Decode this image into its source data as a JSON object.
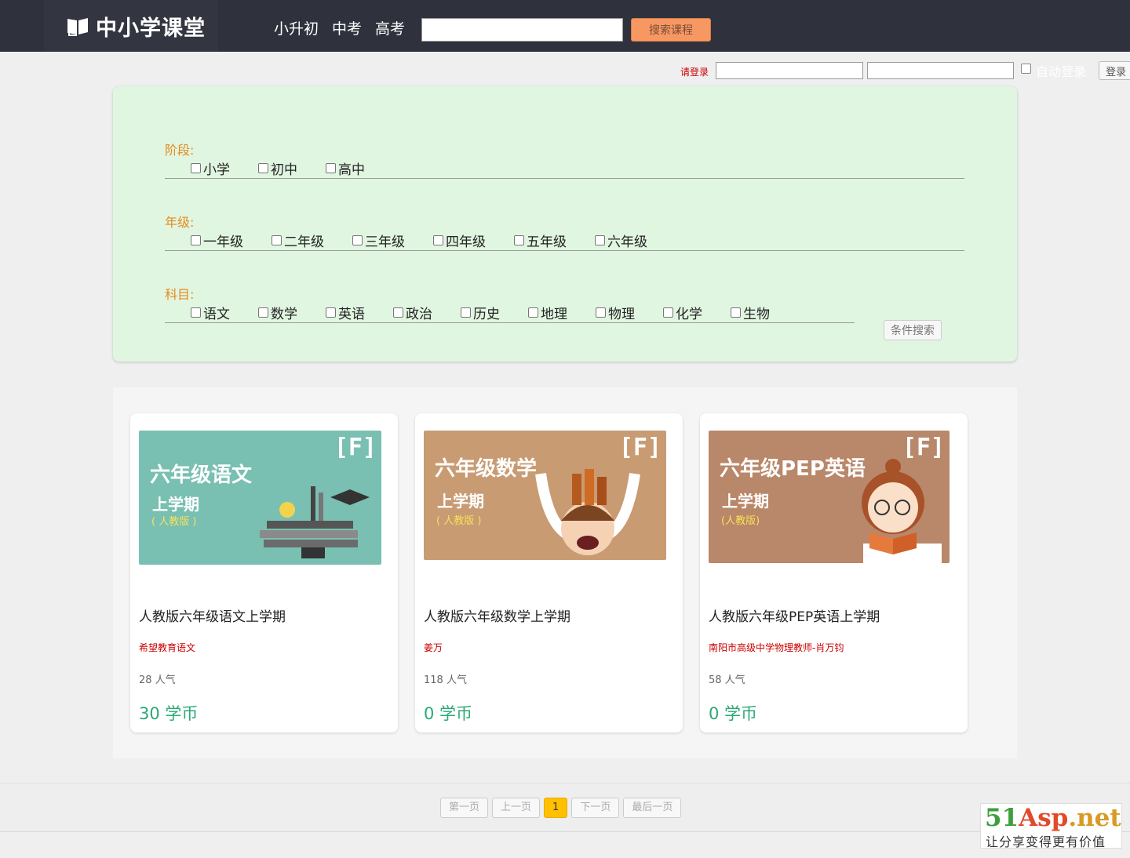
{
  "header": {
    "logo_text": "中小学课堂",
    "nav": [
      "小升初",
      "中考",
      "高考"
    ],
    "search_placeholder": "",
    "search_button": "搜索课程"
  },
  "login": {
    "hint": "请登录",
    "auto_login_label": "自动登录",
    "button": "登录"
  },
  "filter": {
    "groups": [
      {
        "title": "阶段:",
        "options": [
          "小学",
          "初中",
          "高中"
        ]
      },
      {
        "title": "年级:",
        "options": [
          "一年级",
          "二年级",
          "三年级",
          "四年级",
          "五年级",
          "六年级"
        ]
      },
      {
        "title": "科目:",
        "options": [
          "语文",
          "数学",
          "英语",
          "政治",
          "历史",
          "地理",
          "物理",
          "化学",
          "生物"
        ]
      }
    ],
    "search_button": "条件搜索"
  },
  "courses": [
    {
      "thumb_title": "六年级语文",
      "thumb_sub": "上学期",
      "thumb_edition": "( 人教版 )",
      "thumb_color": "#79c0b2",
      "title": "人教版六年级语文上学期",
      "teacher": "希望教育语文",
      "popularity": "28 人气",
      "price": "30 学币"
    },
    {
      "thumb_title": "六年级数学",
      "thumb_sub": "上学期",
      "thumb_edition": "( 人教版 )",
      "thumb_color": "#c99b73",
      "title": "人教版六年级数学上学期",
      "teacher": "姜万",
      "popularity": "118 人气",
      "price": "0 学币"
    },
    {
      "thumb_title": "六年级PEP英语",
      "thumb_sub": "上学期",
      "thumb_edition": "(人教版)",
      "thumb_color": "#b98769",
      "title": "人教版六年级PEP英语上学期",
      "teacher": "南阳市高级中学物理教师-肖万钧",
      "popularity": "58 人气",
      "price": "0 学币"
    }
  ],
  "pager": {
    "first": "第一页",
    "prev": "上一页",
    "current": "1",
    "next": "下一页",
    "last": "最后一页"
  },
  "watermark": {
    "brand_a": "51",
    "brand_b": "Asp",
    "brand_c": ".net",
    "slogan": "让分享变得更有价值"
  },
  "icons": {
    "logo": "open-book-icon",
    "thumb_brand": "brand-f-icon"
  }
}
